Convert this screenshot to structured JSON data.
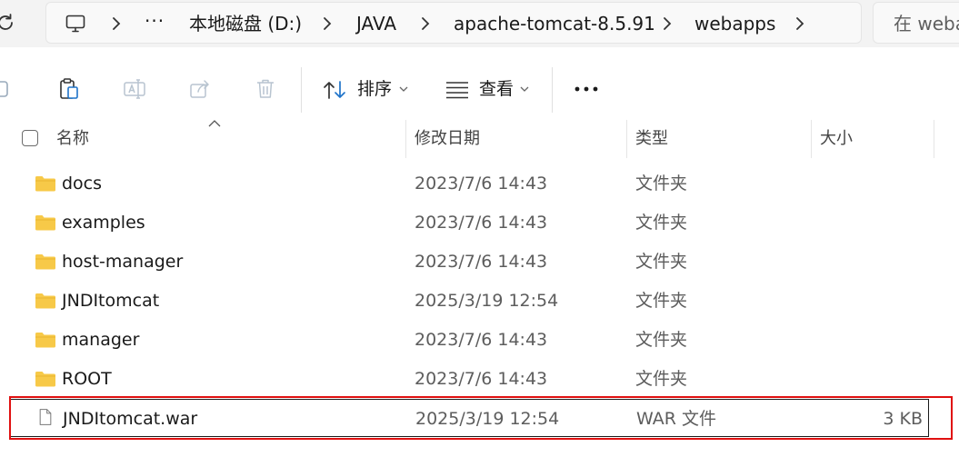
{
  "address_bar": {
    "overflow_label": "···",
    "crumbs": [
      "本地磁盘 (D:)",
      "JAVA",
      "apache-tomcat-8.5.91",
      "webapps"
    ]
  },
  "search": {
    "placeholder": "在 webapps 中搜索"
  },
  "toolbar": {
    "sort_label": "排序",
    "view_label": "查看",
    "more_label": "···"
  },
  "columns": {
    "name": "名称",
    "date": "修改日期",
    "type": "类型",
    "size": "大小"
  },
  "files": [
    {
      "name": "docs",
      "date": "2023/7/6 14:43",
      "type": "文件夹",
      "size": "",
      "icon": "folder-icon"
    },
    {
      "name": "examples",
      "date": "2023/7/6 14:43",
      "type": "文件夹",
      "size": "",
      "icon": "folder-icon"
    },
    {
      "name": "host-manager",
      "date": "2023/7/6 14:43",
      "type": "文件夹",
      "size": "",
      "icon": "folder-icon"
    },
    {
      "name": "JNDItomcat",
      "date": "2025/3/19 12:54",
      "type": "文件夹",
      "size": "",
      "icon": "folder-icon"
    },
    {
      "name": "manager",
      "date": "2023/7/6 14:43",
      "type": "文件夹",
      "size": "",
      "icon": "folder-icon"
    },
    {
      "name": "ROOT",
      "date": "2023/7/6 14:43",
      "type": "文件夹",
      "size": "",
      "icon": "folder-icon"
    },
    {
      "name": "JNDItomcat.war",
      "date": "2025/3/19 12:54",
      "type": "WAR 文件",
      "size": "3 KB",
      "icon": "file-icon"
    }
  ],
  "colors": {
    "folder": "#f7c948",
    "highlight": "#e01010",
    "selection_border": "#1a1a1a"
  }
}
